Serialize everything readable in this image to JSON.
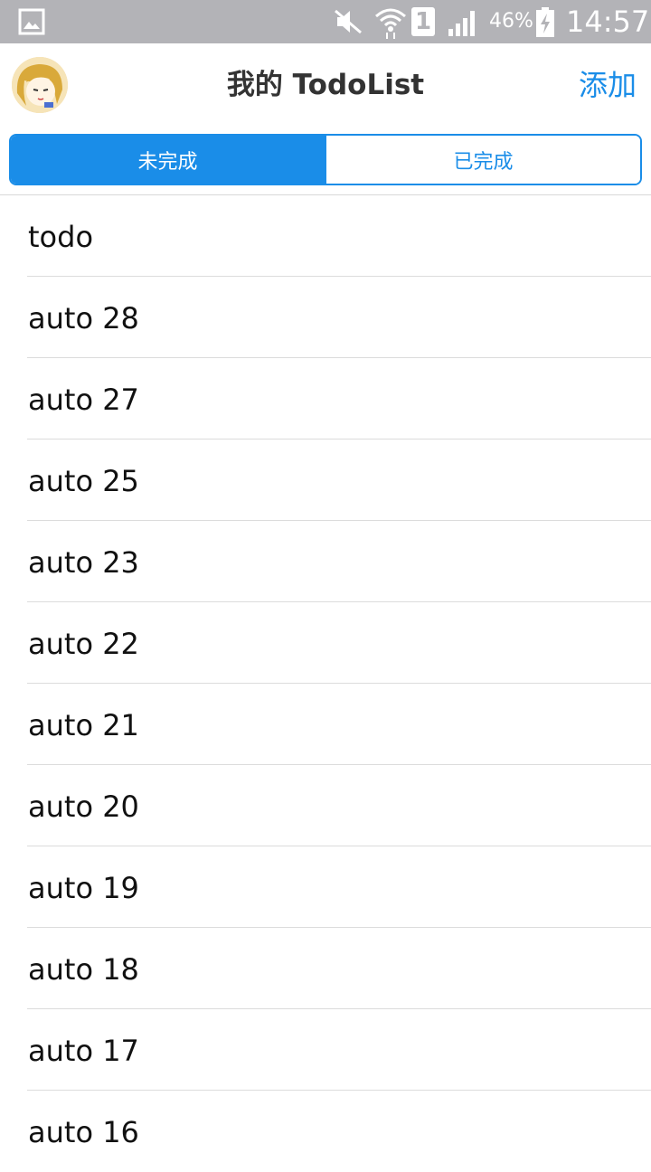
{
  "status_bar": {
    "battery_percent": "46%",
    "time": "14:57",
    "sim_slot": "1",
    "icons": [
      "gallery-icon",
      "mute-icon",
      "wifi-icon",
      "sim-icon",
      "signal-icon",
      "battery-charging-icon"
    ]
  },
  "header": {
    "title": "我的 TodoList",
    "add_label": "添加",
    "avatar": "avatar"
  },
  "tabs": [
    {
      "label": "未完成",
      "active": true
    },
    {
      "label": "已完成",
      "active": false
    }
  ],
  "todos": [
    {
      "label": "todo"
    },
    {
      "label": "auto 28"
    },
    {
      "label": "auto 27"
    },
    {
      "label": "auto 25"
    },
    {
      "label": "auto 23"
    },
    {
      "label": "auto 22"
    },
    {
      "label": "auto 21"
    },
    {
      "label": "auto 20"
    },
    {
      "label": "auto 19"
    },
    {
      "label": "auto 18"
    },
    {
      "label": "auto 17"
    },
    {
      "label": "auto 16"
    }
  ],
  "colors": {
    "accent": "#1a8de8",
    "status_bar": "#b3b3b7",
    "text": "#111111",
    "divider": "#dcdcdc"
  }
}
